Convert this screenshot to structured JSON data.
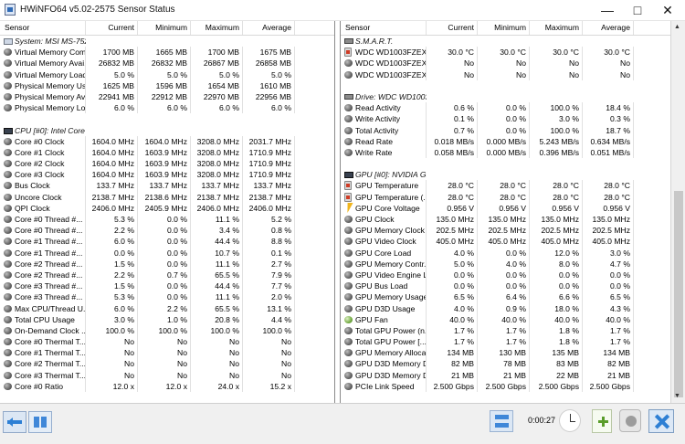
{
  "window": {
    "title": "HWiNFO64 v5.02-2575 Sensor Status",
    "minimize_label": "—",
    "maximize_label": "□",
    "close_label": "✕"
  },
  "columns": {
    "left": [
      "Sensor",
      "Current",
      "Minimum",
      "Maximum",
      "Average"
    ],
    "right": [
      "Sensor",
      "Current",
      "Minimum",
      "Maximum",
      "Average"
    ]
  },
  "icons": {
    "app": "hwinfo-icon",
    "memory": "chip-icon",
    "drive": "drive-icon",
    "gpu": "chip-icon",
    "voltage": "bolt-icon",
    "clock": "clock-icon",
    "fan": "fan-icon",
    "smart": "drive-icon"
  },
  "left_rows": [
    {
      "group": true,
      "sensor": "System: MSI MS-7522"
    },
    {
      "sensor": "Virtual Memory Com...",
      "current": "1700 MB",
      "minimum": "1665 MB",
      "maximum": "1700 MB",
      "average": "1675 MB",
      "icon": "gray"
    },
    {
      "sensor": "Virtual Memory Avai...",
      "current": "26832 MB",
      "minimum": "26832 MB",
      "maximum": "26867 MB",
      "average": "26858 MB",
      "icon": "gray"
    },
    {
      "sensor": "Virtual Memory Load",
      "current": "5.0 %",
      "minimum": "5.0 %",
      "maximum": "5.0 %",
      "average": "5.0 %",
      "icon": "gray"
    },
    {
      "sensor": "Physical Memory Used",
      "current": "1625 MB",
      "minimum": "1596 MB",
      "maximum": "1654 MB",
      "average": "1610 MB",
      "icon": "gray"
    },
    {
      "sensor": "Physical Memory Av...",
      "current": "22941 MB",
      "minimum": "22912 MB",
      "maximum": "22970 MB",
      "average": "22956 MB",
      "icon": "gray"
    },
    {
      "sensor": "Physical Memory Load",
      "current": "6.0 %",
      "minimum": "6.0 %",
      "maximum": "6.0 %",
      "average": "6.0 %",
      "icon": "gray"
    },
    {
      "spacer": true
    },
    {
      "group": true,
      "sensor": "CPU [#0]: Intel Core ..."
    },
    {
      "sensor": "Core #0 Clock",
      "current": "1604.0 MHz",
      "minimum": "1604.0 MHz",
      "maximum": "3208.0 MHz",
      "average": "2031.7 MHz",
      "icon": "gray"
    },
    {
      "sensor": "Core #1 Clock",
      "current": "1604.0 MHz",
      "minimum": "1603.9 MHz",
      "maximum": "3208.0 MHz",
      "average": "1710.9 MHz",
      "icon": "gray"
    },
    {
      "sensor": "Core #2 Clock",
      "current": "1604.0 MHz",
      "minimum": "1603.9 MHz",
      "maximum": "3208.0 MHz",
      "average": "1710.9 MHz",
      "icon": "gray"
    },
    {
      "sensor": "Core #3 Clock",
      "current": "1604.0 MHz",
      "minimum": "1603.9 MHz",
      "maximum": "3208.0 MHz",
      "average": "1710.9 MHz",
      "icon": "gray"
    },
    {
      "sensor": "Bus Clock",
      "current": "133.7 MHz",
      "minimum": "133.7 MHz",
      "maximum": "133.7 MHz",
      "average": "133.7 MHz",
      "icon": "gray"
    },
    {
      "sensor": "Uncore Clock",
      "current": "2138.7 MHz",
      "minimum": "2138.6 MHz",
      "maximum": "2138.7 MHz",
      "average": "2138.7 MHz",
      "icon": "gray"
    },
    {
      "sensor": "QPI Clock",
      "current": "2406.0 MHz",
      "minimum": "2405.9 MHz",
      "maximum": "2406.0 MHz",
      "average": "2406.0 MHz",
      "icon": "gray"
    },
    {
      "sensor": "Core #0 Thread #...",
      "current": "5.3 %",
      "minimum": "0.0 %",
      "maximum": "11.1 %",
      "average": "5.2 %",
      "icon": "gray"
    },
    {
      "sensor": "Core #0 Thread #...",
      "current": "2.2 %",
      "minimum": "0.0 %",
      "maximum": "3.4 %",
      "average": "0.8 %",
      "icon": "gray"
    },
    {
      "sensor": "Core #1 Thread #...",
      "current": "6.0 %",
      "minimum": "0.0 %",
      "maximum": "44.4 %",
      "average": "8.8 %",
      "icon": "gray"
    },
    {
      "sensor": "Core #1 Thread #...",
      "current": "0.0 %",
      "minimum": "0.0 %",
      "maximum": "10.7 %",
      "average": "0.1 %",
      "icon": "gray"
    },
    {
      "sensor": "Core #2 Thread #...",
      "current": "1.5 %",
      "minimum": "0.0 %",
      "maximum": "11.1 %",
      "average": "2.7 %",
      "icon": "gray"
    },
    {
      "sensor": "Core #2 Thread #...",
      "current": "2.2 %",
      "minimum": "0.7 %",
      "maximum": "65.5 %",
      "average": "7.9 %",
      "icon": "gray"
    },
    {
      "sensor": "Core #3 Thread #...",
      "current": "1.5 %",
      "minimum": "0.0 %",
      "maximum": "44.4 %",
      "average": "7.7 %",
      "icon": "gray"
    },
    {
      "sensor": "Core #3 Thread #...",
      "current": "5.3 %",
      "minimum": "0.0 %",
      "maximum": "11.1 %",
      "average": "2.0 %",
      "icon": "gray"
    },
    {
      "sensor": "Max CPU/Thread U...",
      "current": "6.0 %",
      "minimum": "2.2 %",
      "maximum": "65.5 %",
      "average": "13.1 %",
      "icon": "gray"
    },
    {
      "sensor": "Total CPU Usage",
      "current": "3.0 %",
      "minimum": "1.0 %",
      "maximum": "20.8 %",
      "average": "4.4 %",
      "icon": "gray"
    },
    {
      "sensor": "On-Demand Clock ...",
      "current": "100.0 %",
      "minimum": "100.0 %",
      "maximum": "100.0 %",
      "average": "100.0 %",
      "icon": "gray"
    },
    {
      "sensor": "Core #0 Thermal T...",
      "current": "No",
      "minimum": "No",
      "maximum": "No",
      "average": "No",
      "icon": "gray"
    },
    {
      "sensor": "Core #1 Thermal T...",
      "current": "No",
      "minimum": "No",
      "maximum": "No",
      "average": "No",
      "icon": "gray"
    },
    {
      "sensor": "Core #2 Thermal T...",
      "current": "No",
      "minimum": "No",
      "maximum": "No",
      "average": "No",
      "icon": "gray"
    },
    {
      "sensor": "Core #3 Thermal T...",
      "current": "No",
      "minimum": "No",
      "maximum": "No",
      "average": "No",
      "icon": "gray"
    },
    {
      "sensor": "Core #0 Ratio",
      "current": "12.0 x",
      "minimum": "12.0 x",
      "maximum": "24.0 x",
      "average": "15.2 x",
      "icon": "gray"
    }
  ],
  "right_rows": [
    {
      "group": true,
      "sensor": "S.M.A.R.T."
    },
    {
      "sensor": "WDC WD1003FZEX...",
      "current": "30.0 °C",
      "minimum": "30.0 °C",
      "maximum": "30.0 °C",
      "average": "30.0 °C",
      "icon": "red"
    },
    {
      "sensor": "WDC WD1003FZEX...",
      "current": "No",
      "minimum": "No",
      "maximum": "No",
      "average": "No",
      "icon": "gray"
    },
    {
      "sensor": "WDC WD1003FZEX...",
      "current": "No",
      "minimum": "No",
      "maximum": "No",
      "average": "No",
      "icon": "gray"
    },
    {
      "spacer": true
    },
    {
      "group": true,
      "sensor": "Drive: WDC WD1003..."
    },
    {
      "sensor": "Read Activity",
      "current": "0.6 %",
      "minimum": "0.0 %",
      "maximum": "100.0 %",
      "average": "18.4 %",
      "icon": "gray"
    },
    {
      "sensor": "Write Activity",
      "current": "0.1 %",
      "minimum": "0.0 %",
      "maximum": "3.0 %",
      "average": "0.3 %",
      "icon": "gray"
    },
    {
      "sensor": "Total Activity",
      "current": "0.7 %",
      "minimum": "0.0 %",
      "maximum": "100.0 %",
      "average": "18.7 %",
      "icon": "gray"
    },
    {
      "sensor": "Read Rate",
      "current": "0.018 MB/s",
      "minimum": "0.000 MB/s",
      "maximum": "5.243 MB/s",
      "average": "0.634 MB/s",
      "icon": "gray"
    },
    {
      "sensor": "Write Rate",
      "current": "0.058 MB/s",
      "minimum": "0.000 MB/s",
      "maximum": "0.396 MB/s",
      "average": "0.051 MB/s",
      "icon": "gray"
    },
    {
      "spacer": true
    },
    {
      "group": true,
      "sensor": "GPU [#0]: NVIDIA G..."
    },
    {
      "sensor": "GPU Temperature",
      "current": "28.0 °C",
      "minimum": "28.0 °C",
      "maximum": "28.0 °C",
      "average": "28.0 °C",
      "icon": "red"
    },
    {
      "sensor": "GPU Temperature (...",
      "current": "28.0 °C",
      "minimum": "28.0 °C",
      "maximum": "28.0 °C",
      "average": "28.0 °C",
      "icon": "red"
    },
    {
      "sensor": "GPU Core Voltage",
      "current": "0.956 V",
      "minimum": "0.956 V",
      "maximum": "0.956 V",
      "average": "0.956 V",
      "icon": "bolt"
    },
    {
      "sensor": "GPU Clock",
      "current": "135.0 MHz",
      "minimum": "135.0 MHz",
      "maximum": "135.0 MHz",
      "average": "135.0 MHz",
      "icon": "gray"
    },
    {
      "sensor": "GPU Memory Clock",
      "current": "202.5 MHz",
      "minimum": "202.5 MHz",
      "maximum": "202.5 MHz",
      "average": "202.5 MHz",
      "icon": "gray"
    },
    {
      "sensor": "GPU Video Clock",
      "current": "405.0 MHz",
      "minimum": "405.0 MHz",
      "maximum": "405.0 MHz",
      "average": "405.0 MHz",
      "icon": "gray"
    },
    {
      "sensor": "GPU Core Load",
      "current": "4.0 %",
      "minimum": "0.0 %",
      "maximum": "12.0 %",
      "average": "3.0 %",
      "icon": "gray"
    },
    {
      "sensor": "GPU Memory Contr...",
      "current": "5.0 %",
      "minimum": "4.0 %",
      "maximum": "8.0 %",
      "average": "4.7 %",
      "icon": "gray"
    },
    {
      "sensor": "GPU Video Engine L...",
      "current": "0.0 %",
      "minimum": "0.0 %",
      "maximum": "0.0 %",
      "average": "0.0 %",
      "icon": "gray"
    },
    {
      "sensor": "GPU Bus Load",
      "current": "0.0 %",
      "minimum": "0.0 %",
      "maximum": "0.0 %",
      "average": "0.0 %",
      "icon": "gray"
    },
    {
      "sensor": "GPU Memory Usage",
      "current": "6.5 %",
      "minimum": "6.4 %",
      "maximum": "6.6 %",
      "average": "6.5 %",
      "icon": "gray"
    },
    {
      "sensor": "GPU D3D Usage",
      "current": "4.0 %",
      "minimum": "0.9 %",
      "maximum": "18.0 %",
      "average": "4.3 %",
      "icon": "gray"
    },
    {
      "sensor": "GPU Fan",
      "current": "40.0 %",
      "minimum": "40.0 %",
      "maximum": "40.0 %",
      "average": "40.0 %",
      "icon": "green"
    },
    {
      "sensor": "Total GPU Power (n...",
      "current": "1.7 %",
      "minimum": "1.7 %",
      "maximum": "1.8 %",
      "average": "1.7 %",
      "icon": "gray"
    },
    {
      "sensor": "Total GPU Power [...",
      "current": "1.7 %",
      "minimum": "1.7 %",
      "maximum": "1.8 %",
      "average": "1.7 %",
      "icon": "gray"
    },
    {
      "sensor": "GPU Memory Alloca...",
      "current": "134 MB",
      "minimum": "130 MB",
      "maximum": "135 MB",
      "average": "134 MB",
      "icon": "gray"
    },
    {
      "sensor": "GPU D3D Memory D...",
      "current": "82 MB",
      "minimum": "78 MB",
      "maximum": "83 MB",
      "average": "82 MB",
      "icon": "gray"
    },
    {
      "sensor": "GPU D3D Memory D...",
      "current": "21 MB",
      "minimum": "21 MB",
      "maximum": "22 MB",
      "average": "21 MB",
      "icon": "gray"
    },
    {
      "sensor": "PCIe Link Speed",
      "current": "2.500 Gbps",
      "minimum": "2.500 Gbps",
      "maximum": "2.500 Gbps",
      "average": "2.500 Gbps",
      "icon": "gray"
    }
  ],
  "toolbar": {
    "timer": "0:00:27"
  }
}
